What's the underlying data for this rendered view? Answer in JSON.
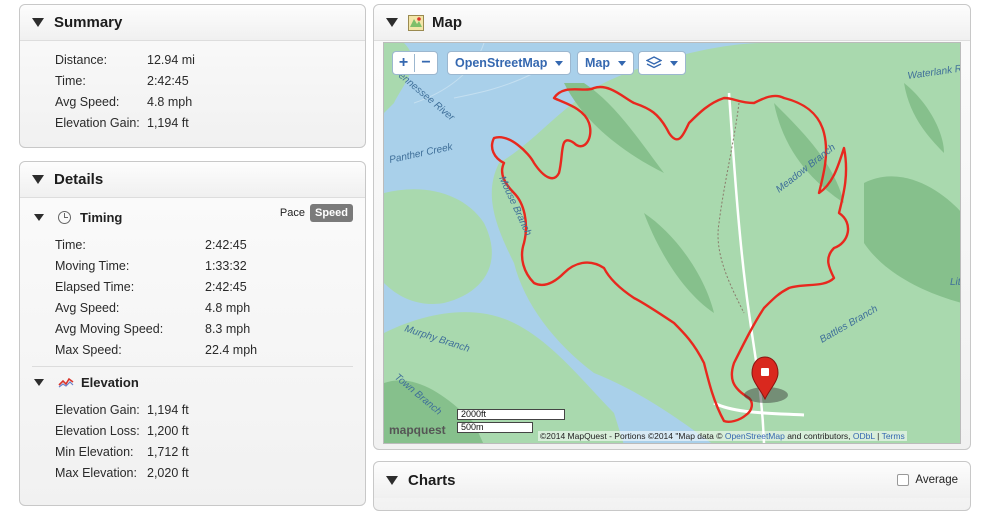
{
  "summary": {
    "title": "Summary",
    "rows": [
      {
        "label": "Distance:",
        "value": "12.94 mi"
      },
      {
        "label": "Time:",
        "value": "2:42:45"
      },
      {
        "label": "Avg Speed:",
        "value": "4.8 mph"
      },
      {
        "label": "Elevation Gain:",
        "value": "1,194 ft"
      }
    ]
  },
  "details": {
    "title": "Details",
    "timing": {
      "title": "Timing",
      "toggle": {
        "pace": "Pace",
        "speed": "Speed"
      },
      "rows": [
        {
          "label": "Time:",
          "value": "2:42:45"
        },
        {
          "label": "Moving Time:",
          "value": "1:33:32"
        },
        {
          "label": "Elapsed Time:",
          "value": "2:42:45"
        },
        {
          "label": "Avg Speed:",
          "value": "4.8 mph"
        },
        {
          "label": "Avg Moving Speed:",
          "value": "8.3 mph"
        },
        {
          "label": "Max Speed:",
          "value": "22.4 mph"
        }
      ]
    },
    "elevation": {
      "title": "Elevation",
      "rows": [
        {
          "label": "Elevation Gain:",
          "value": "1,194 ft"
        },
        {
          "label": "Elevation Loss:",
          "value": "1,200 ft"
        },
        {
          "label": "Min Elevation:",
          "value": "1,712 ft"
        },
        {
          "label": "Max Elevation:",
          "value": "2,020 ft"
        }
      ]
    }
  },
  "map": {
    "title": "Map",
    "zoom_in": "+",
    "zoom_out": "−",
    "provider_select": "OpenStreetMap",
    "type_select": "Map",
    "labels": {
      "tennessee_river": "Tennessee River",
      "panther_creek": "Panther Creek",
      "waterlank": "Waterlank R",
      "mouse_branch": "Mouse Branch",
      "meadow_branch": "Meadow Branch",
      "murphy_branch": "Murphy Branch",
      "battles_branch": "Battles Branch",
      "town_branch": "Town Branch",
      "lit": "Lit"
    },
    "scale_ft": "2000ft",
    "scale_m": "500m",
    "brand": "mapquest",
    "attribution_prefix": "©2014 MapQuest  -  Portions ©2014 \"Map data © ",
    "attribution_osm": "OpenStreetMap",
    "attribution_mid": " and contributors, ",
    "attribution_odbl": "ODbL",
    "attribution_sep": " | ",
    "attribution_terms": "Terms",
    "colors": {
      "route": "#e8281e",
      "water": "#a9d0ea",
      "land": "#a9d9ae",
      "land_dark": "#86c08c",
      "link": "#3568b0"
    }
  },
  "charts": {
    "title": "Charts",
    "average_label": "Average"
  }
}
